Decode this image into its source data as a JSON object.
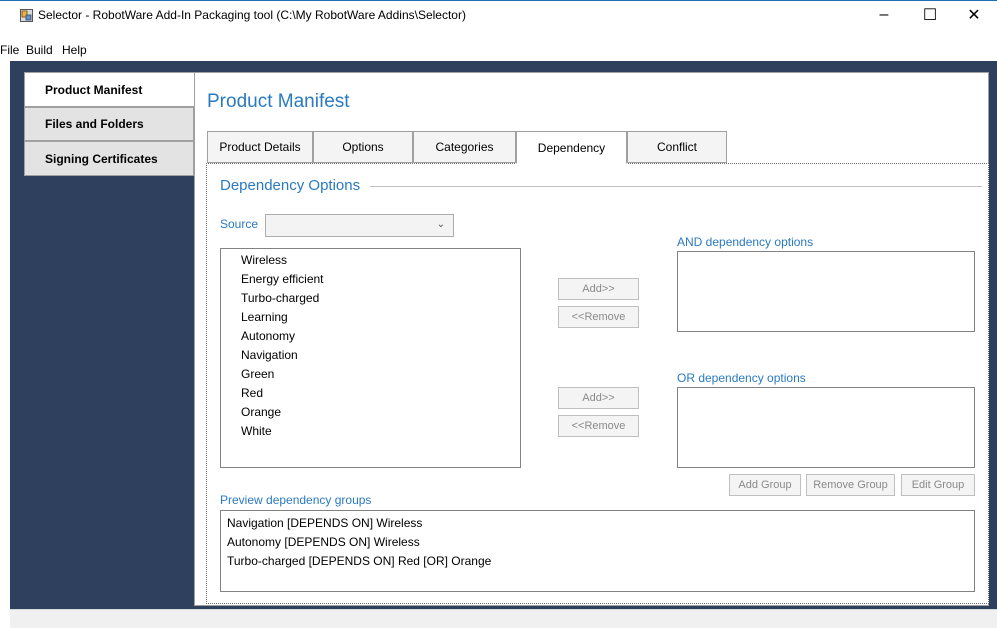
{
  "window": {
    "title": "Selector - RobotWare Add-In Packaging tool (C:\\My RobotWare Addins\\Selector)",
    "minimize_glyph": "–",
    "maximize_glyph": "☐",
    "close_glyph": "✕"
  },
  "menu": [
    "File",
    "Build",
    "Help"
  ],
  "sidebar": {
    "items": [
      {
        "label": "Product Manifest",
        "active": true
      },
      {
        "label": "Files and Folders",
        "active": false
      },
      {
        "label": "Signing Certificates",
        "active": false
      }
    ]
  },
  "main": {
    "title": "Product Manifest",
    "tabs": [
      {
        "label": "Product Details",
        "active": false
      },
      {
        "label": "Options",
        "active": false
      },
      {
        "label": "Categories",
        "active": false
      },
      {
        "label": "Dependency",
        "active": true
      },
      {
        "label": "Conflict",
        "active": false
      }
    ]
  },
  "dependency": {
    "group_title": "Dependency Options",
    "source_label": "Source",
    "source_value": "",
    "source_options": [
      "Wireless",
      "Energy efficient",
      "Turbo-charged",
      "Learning",
      "Autonomy",
      "Navigation",
      "Green",
      "Red",
      "Orange",
      "White"
    ],
    "and_label": "AND dependency options",
    "or_label": "OR dependency options",
    "add_button": "Add>>",
    "remove_button": "<<Remove",
    "add_group_button": "Add Group",
    "remove_group_button": "Remove Group",
    "edit_group_button": "Edit Group",
    "preview_label": "Preview dependency groups",
    "preview_items": [
      "Navigation [DEPENDS ON] Wireless",
      "Autonomy [DEPENDS ON] Wireless",
      "Turbo-charged [DEPENDS ON] Red [OR] Orange"
    ]
  },
  "colors": {
    "accent": "#2a7ac0",
    "background": "#2f3f5e"
  }
}
